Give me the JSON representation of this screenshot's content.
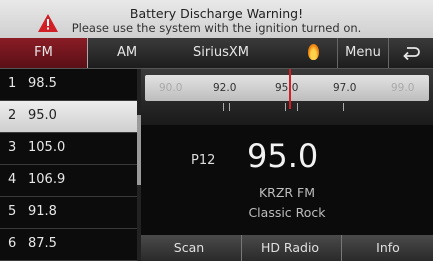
{
  "warning": {
    "title": "Battery Discharge Warning!",
    "message": "Please use the system with the ignition turned on."
  },
  "tabs": {
    "fm": "FM",
    "am": "AM",
    "siriusxm": "SiriusXM",
    "menu": "Menu",
    "back": "⮌"
  },
  "presets": [
    {
      "num": "1",
      "freq": "98.5"
    },
    {
      "num": "2",
      "freq": "95.0"
    },
    {
      "num": "3",
      "freq": "105.0"
    },
    {
      "num": "4",
      "freq": "106.9"
    },
    {
      "num": "5",
      "freq": "91.8"
    },
    {
      "num": "6",
      "freq": "87.5"
    }
  ],
  "tuner": {
    "ticks": [
      "90.0",
      "92.0",
      "95.0",
      "97.0",
      "99.0"
    ]
  },
  "now_playing": {
    "preset": "P12",
    "frequency": "95.0",
    "station": "KRZR FM",
    "genre": "Classic Rock"
  },
  "buttons": {
    "scan": "Scan",
    "hd_radio": "HD Radio",
    "info": "Info"
  },
  "colors": {
    "accent": "#8a1c25",
    "needle": "#d21f26",
    "warning_icon": "#d11f26"
  },
  "icons": [
    "warning-icon",
    "voice-icon",
    "back-icon"
  ]
}
